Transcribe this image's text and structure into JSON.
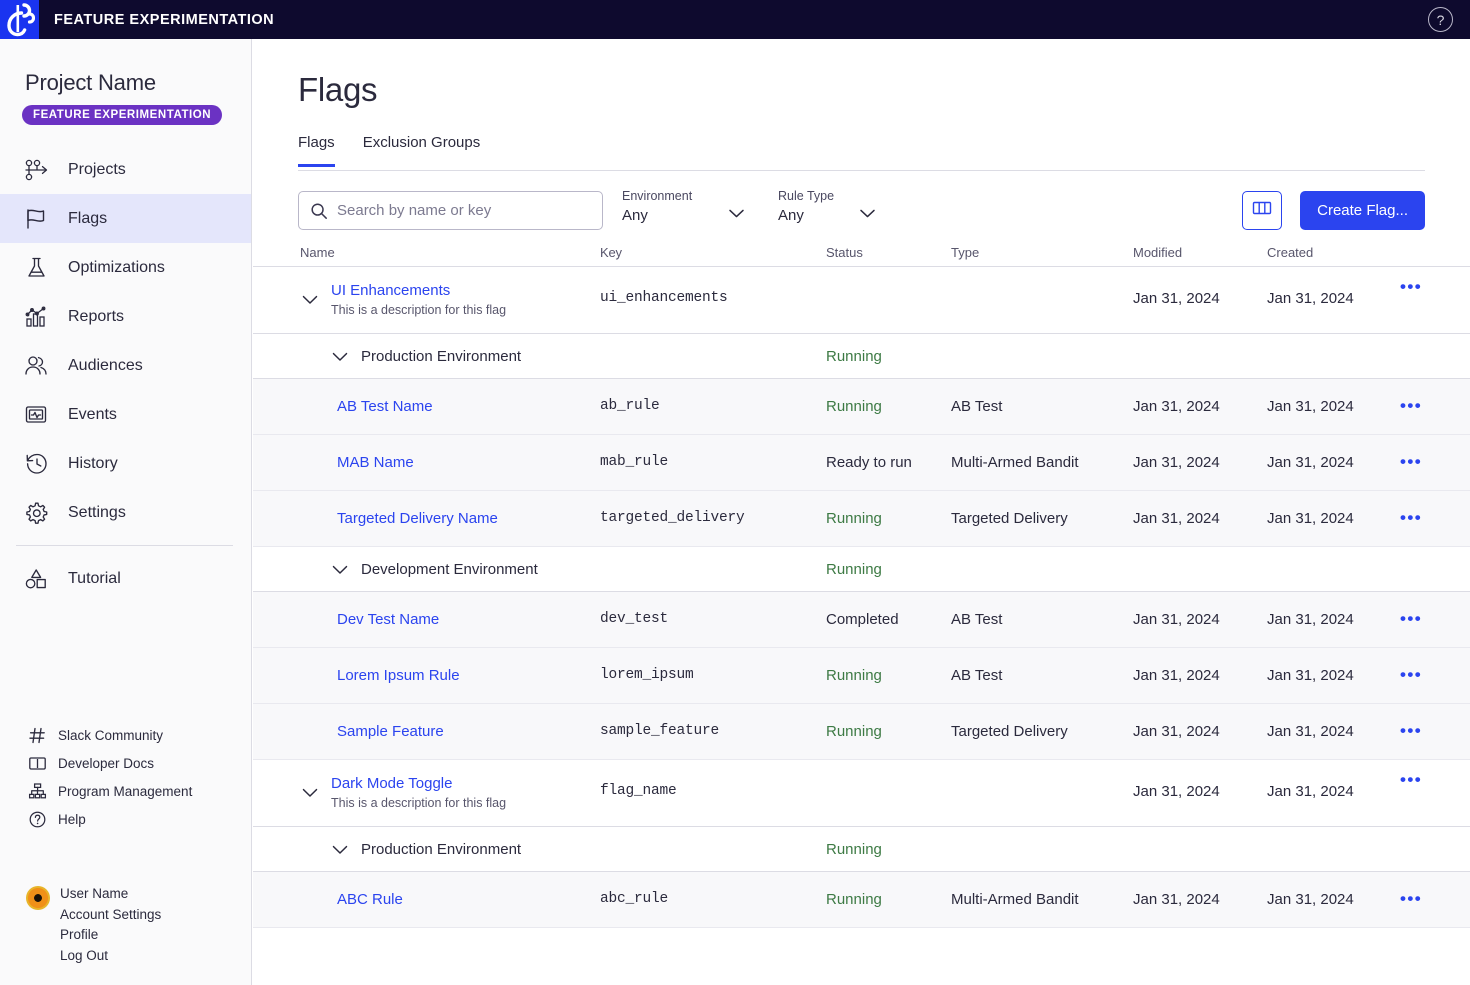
{
  "topbar": {
    "title": "FEATURE EXPERIMENTATION",
    "logo_name": "optimizely-logo",
    "help_glyph": "?"
  },
  "sidebar": {
    "project_name": "Project Name",
    "project_badge": "FEATURE EXPERIMENTATION",
    "items": [
      {
        "label": "Projects",
        "icon": "projects-icon",
        "active": false
      },
      {
        "label": "Flags",
        "icon": "flag-icon",
        "active": true
      },
      {
        "label": "Optimizations",
        "icon": "flask-icon",
        "active": false
      },
      {
        "label": "Reports",
        "icon": "bar-chart-icon",
        "active": false
      },
      {
        "label": "Audiences",
        "icon": "users-icon",
        "active": false
      },
      {
        "label": "Events",
        "icon": "monitor-pulse-icon",
        "active": false
      },
      {
        "label": "History",
        "icon": "clock-rewind-icon",
        "active": false
      },
      {
        "label": "Settings",
        "icon": "gear-icon",
        "active": false
      },
      {
        "label": "Tutorial",
        "icon": "shapes-icon",
        "active": false
      }
    ],
    "footer_items": [
      {
        "label": "Slack Community",
        "icon": "hash-icon"
      },
      {
        "label": "Developer Docs",
        "icon": "book-icon"
      },
      {
        "label": "Program Management",
        "icon": "org-chart-icon"
      },
      {
        "label": "Help",
        "icon": "question-circle-icon"
      }
    ],
    "user": {
      "name": "User Name",
      "links": [
        "Account Settings",
        "Profile",
        "Log Out"
      ]
    }
  },
  "main": {
    "page_title": "Flags",
    "tabs": [
      {
        "label": "Flags",
        "active": true
      },
      {
        "label": "Exclusion Groups",
        "active": false
      }
    ],
    "search": {
      "placeholder": "Search by name or key",
      "value": ""
    },
    "filters": [
      {
        "label": "Environment",
        "value": "Any"
      },
      {
        "label": "Rule Type",
        "value": "Any"
      }
    ],
    "column_picker_name": "column-picker-icon",
    "create_button": "Create Flag...",
    "columns": [
      "Name",
      "Key",
      "Status",
      "Type",
      "Modified",
      "Created"
    ],
    "rows": [
      {
        "kind": "flag",
        "name": "UI Enhancements",
        "description": "This is a description for this flag",
        "key": "ui_enhancements",
        "status": "",
        "type": "",
        "modified": "Jan 31, 2024",
        "created": "Jan 31, 2024",
        "menu": "•••"
      },
      {
        "kind": "env",
        "name": "Production Environment",
        "key": "",
        "status": "Running",
        "status_state": "running",
        "type": "",
        "modified": "",
        "created": "",
        "menu": ""
      },
      {
        "kind": "rule",
        "name": "AB Test Name",
        "key": "ab_rule",
        "status": "Running",
        "status_state": "running",
        "type": "AB Test",
        "modified": "Jan 31, 2024",
        "created": "Jan 31, 2024",
        "menu": "•••"
      },
      {
        "kind": "rule",
        "name": "MAB Name",
        "key": "mab_rule",
        "status": "Ready to run",
        "status_state": "plain",
        "type": "Multi-Armed Bandit",
        "modified": "Jan 31, 2024",
        "created": "Jan 31, 2024",
        "menu": "•••"
      },
      {
        "kind": "rule",
        "name": "Targeted Delivery Name",
        "key": "targeted_delivery",
        "status": "Running",
        "status_state": "running",
        "type": "Targeted Delivery",
        "modified": "Jan 31, 2024",
        "created": "Jan 31, 2024",
        "menu": "•••"
      },
      {
        "kind": "env",
        "name": "Development Environment",
        "key": "",
        "status": "Running",
        "status_state": "running",
        "type": "",
        "modified": "",
        "created": "",
        "menu": ""
      },
      {
        "kind": "rule",
        "name": "Dev Test Name",
        "key": "dev_test",
        "status": "Completed",
        "status_state": "plain",
        "type": "AB Test",
        "modified": "Jan 31, 2024",
        "created": "Jan 31, 2024",
        "menu": "•••"
      },
      {
        "kind": "rule",
        "name": "Lorem Ipsum Rule",
        "key": "lorem_ipsum",
        "status": "Running",
        "status_state": "running",
        "type": "AB Test",
        "modified": "Jan 31, 2024",
        "created": "Jan 31, 2024",
        "menu": "•••"
      },
      {
        "kind": "rule",
        "name": "Sample Feature",
        "key": "sample_feature",
        "status": "Running",
        "status_state": "running",
        "type": "Targeted Delivery",
        "modified": "Jan 31, 2024",
        "created": "Jan 31, 2024",
        "menu": "•••"
      },
      {
        "kind": "flag",
        "name": "Dark Mode Toggle",
        "description": "This is a description for this flag",
        "key": "flag_name",
        "status": "",
        "type": "",
        "modified": "Jan 31, 2024",
        "created": "Jan 31, 2024",
        "menu": "•••"
      },
      {
        "kind": "env",
        "name": "Production Environment",
        "key": "",
        "status": "Running",
        "status_state": "running",
        "type": "",
        "modified": "",
        "created": "",
        "menu": ""
      },
      {
        "kind": "rule",
        "name": "ABC Rule",
        "key": "abc_rule",
        "status": "Running",
        "status_state": "running",
        "type": "Multi-Armed Bandit",
        "modified": "Jan 31, 2024",
        "created": "Jan 31, 2024",
        "menu": "•••"
      }
    ]
  },
  "colors": {
    "brand_blue": "#2b44ef",
    "topbar_navy": "#0e0a2e",
    "badge_purple": "#6b32c3",
    "status_green": "#3d7a44",
    "sidebar_bg": "#fafafb",
    "active_nav_bg": "#e4e6fb"
  }
}
